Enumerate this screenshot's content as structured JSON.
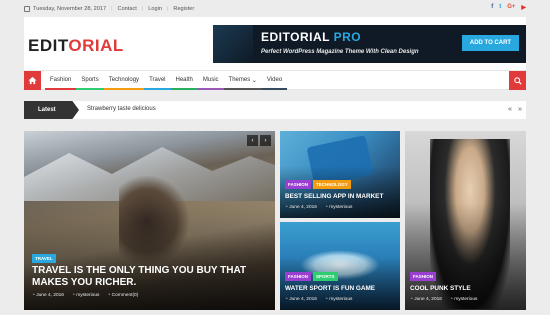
{
  "topbar": {
    "date": "Tuesday, November 28, 2017",
    "links": [
      "Contact",
      "Login",
      "Register"
    ],
    "social": [
      {
        "icon": "facebook-icon",
        "glyph": "f"
      },
      {
        "icon": "twitter-icon",
        "glyph": "t"
      },
      {
        "icon": "google-plus-icon",
        "glyph": "G+"
      },
      {
        "icon": "youtube-icon",
        "glyph": "▶"
      }
    ]
  },
  "logo": {
    "part1": "EDIT",
    "part2": "ORIAL"
  },
  "banner": {
    "title_main": "EDITORIAL ",
    "title_accent": "PRO",
    "subtitle": "Perfect WordPress Magazine Theme With Clean Design",
    "button": "ADD TO CART"
  },
  "nav": {
    "items": [
      {
        "label": "Fashion",
        "color": "#e03a3a"
      },
      {
        "label": "Sports",
        "color": "#2ecc71"
      },
      {
        "label": "Technology",
        "color": "#f39c12"
      },
      {
        "label": "Travel",
        "color": "#29a8e0"
      },
      {
        "label": "Health",
        "color": "#27ae60"
      },
      {
        "label": "Music",
        "color": "#9b59b6"
      },
      {
        "label": "Themes",
        "color": "#555555"
      },
      {
        "label": "Video",
        "color": "#34495e"
      }
    ],
    "themes_caret": "⌄"
  },
  "ticker": {
    "label": "Latest",
    "headline": "Strawberry taste delicious",
    "prev": "«",
    "next": "»"
  },
  "posts": {
    "main": {
      "tag": "TRAVEL",
      "tag_color": "#29a8e0",
      "title": "TRAVEL IS THE ONLY THING YOU BUY THAT MAKES YOU RICHER.",
      "date": "June 4, 2016",
      "author": "mysterious",
      "comments": "Comment(0)",
      "slider_prev": "‹",
      "slider_next": "›"
    },
    "app": {
      "tags": [
        {
          "label": "FASHION",
          "color": "#9b3fd1"
        },
        {
          "label": "TECHNOLOGY",
          "color": "#f39c12"
        }
      ],
      "title": "BEST SELLING APP IN MARKET",
      "date": "June 4, 2016",
      "author": "mysterious"
    },
    "water": {
      "tags": [
        {
          "label": "FASHION",
          "color": "#9b3fd1"
        },
        {
          "label": "SPORTS",
          "color": "#2ecc71"
        }
      ],
      "title": "WATER SPORT IS FUN GAME",
      "date": "June 4, 2016",
      "author": "mysterious"
    },
    "punk": {
      "tags": [
        {
          "label": "FASHION",
          "color": "#9b3fd1"
        }
      ],
      "title": "COOL PUNK STYLE",
      "date": "June 4, 2016",
      "author": "mysterious"
    }
  }
}
